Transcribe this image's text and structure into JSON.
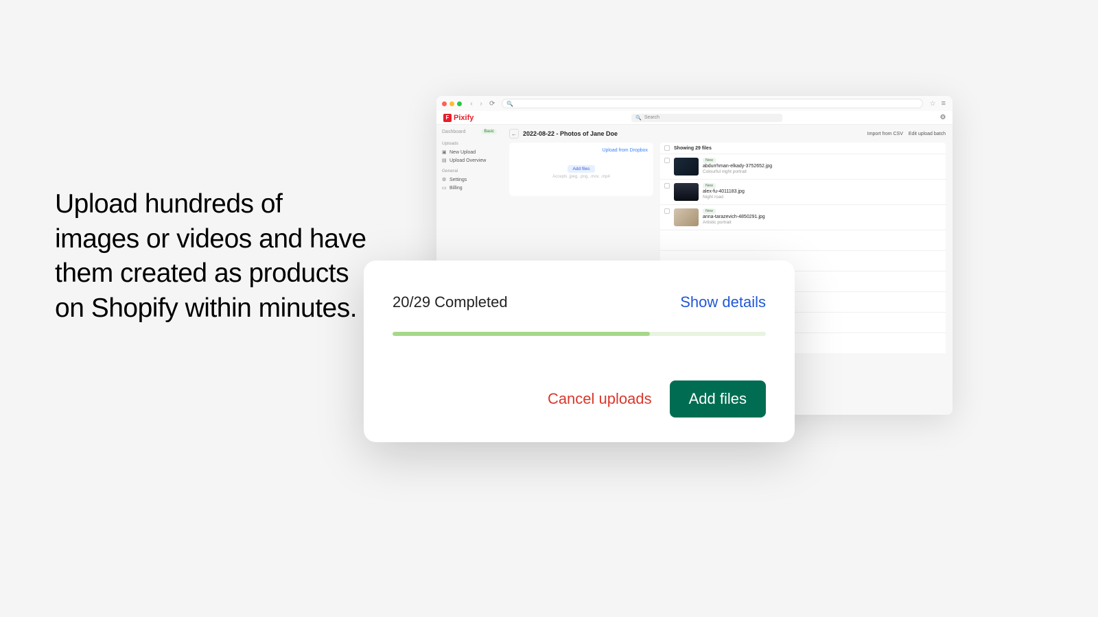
{
  "headline": "Upload hundreds of images or videos and have them created as products on Shopify within minutes.",
  "browser": {
    "star_icon": "☆",
    "menu_icon": "≡"
  },
  "app": {
    "logo_mark": "F",
    "logo_text": "Pixify",
    "search_placeholder": "Search"
  },
  "sidebar": {
    "dashboard": "Dashboard",
    "badge": "Basic",
    "groups": [
      {
        "label": "Uploads",
        "items": [
          {
            "icon": "▣",
            "label": "New Upload"
          },
          {
            "icon": "▤",
            "label": "Upload Overview"
          }
        ]
      },
      {
        "label": "General",
        "items": [
          {
            "icon": "⚙",
            "label": "Settings"
          },
          {
            "icon": "▭",
            "label": "Billing"
          }
        ]
      }
    ]
  },
  "crumb": {
    "title": "2022-08-22 - Photos of Jane Doe",
    "actions": [
      "Import from CSV",
      "Edit upload batch"
    ]
  },
  "upload_card": {
    "dropbox": "Upload from Dropbox",
    "add_files": "Add files",
    "accepts": "Accepts .jpeg, .png, .mov, .mp4"
  },
  "files": {
    "header": "Showing 29 files",
    "rows": [
      {
        "badge": "New",
        "name": "abdurrhman-elkady-3752652.jpg",
        "desc": "Colourful night portrait"
      },
      {
        "badge": "New",
        "name": "alex-fu-4011183.jpg",
        "desc": "Night road"
      },
      {
        "badge": "New",
        "name": "anna-tarazevich-4850291.jpg",
        "desc": "Artistic portrait"
      }
    ]
  },
  "modal": {
    "status": "20/29 Completed",
    "show_details": "Show details",
    "cancel": "Cancel uploads",
    "add_files": "Add files"
  }
}
